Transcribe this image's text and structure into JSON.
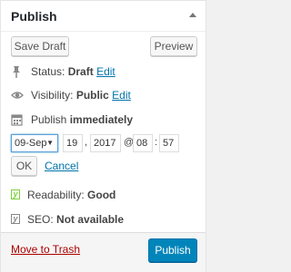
{
  "box": {
    "title": "Publish",
    "save_draft_label": "Save Draft",
    "preview_label": "Preview",
    "status_label": "Status:",
    "status_value": "Draft",
    "status_edit": "Edit",
    "visibility_label": "Visibility:",
    "visibility_value": "Public",
    "visibility_edit": "Edit",
    "publish_label": "Publish",
    "publish_value": "immediately",
    "date": {
      "month": "09-Sep",
      "day": "19",
      "year": "2017",
      "at": "@",
      "hour": "08",
      "minute": "57"
    },
    "ok_label": "OK",
    "cancel_label": "Cancel",
    "readability_label": "Readability:",
    "readability_value": "Good",
    "seo_label": "SEO:",
    "seo_value": "Not available",
    "trash_label": "Move to Trash",
    "publish_button_label": "Publish"
  },
  "icons": {
    "status": "pin-icon",
    "visibility": "eye-icon",
    "schedule": "calendar-icon",
    "readability": "yoast-icon",
    "seo": "yoast-icon",
    "toggle": "caret-up-icon"
  },
  "colors": {
    "link": "#0073aa",
    "trash": "#a00000",
    "primary": "#0085ba",
    "readability_good": "#7ad03a"
  }
}
